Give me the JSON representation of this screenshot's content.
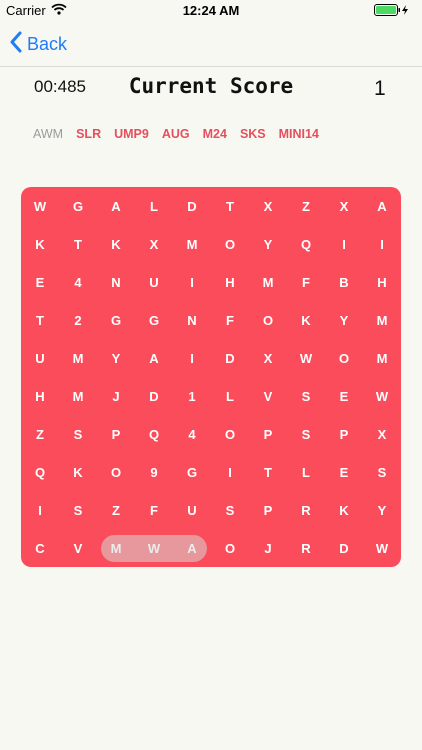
{
  "status_bar": {
    "carrier": "Carrier",
    "time": "12:24 AM"
  },
  "nav": {
    "back_label": "Back"
  },
  "header": {
    "timer": "00:485",
    "title": "Current Score",
    "score": "1"
  },
  "colors": {
    "accent": "#fb4c5b",
    "link": "#1f7cf6",
    "found_word": "#9b9b9b"
  },
  "words": [
    {
      "label": "AWM",
      "found": true
    },
    {
      "label": "SLR",
      "found": false
    },
    {
      "label": "UMP9",
      "found": false
    },
    {
      "label": "AUG",
      "found": false
    },
    {
      "label": "M24",
      "found": false
    },
    {
      "label": "SKS",
      "found": false
    },
    {
      "label": "MINI14",
      "found": false
    }
  ],
  "grid": [
    [
      "W",
      "G",
      "A",
      "L",
      "D",
      "T",
      "X",
      "Z",
      "X",
      "A"
    ],
    [
      "K",
      "T",
      "K",
      "X",
      "M",
      "O",
      "Y",
      "Q",
      "I",
      "I"
    ],
    [
      "E",
      "4",
      "N",
      "U",
      "I",
      "H",
      "M",
      "F",
      "B",
      "H"
    ],
    [
      "T",
      "2",
      "G",
      "G",
      "N",
      "F",
      "O",
      "K",
      "Y",
      "M"
    ],
    [
      "U",
      "M",
      "Y",
      "A",
      "I",
      "D",
      "X",
      "W",
      "O",
      "M"
    ],
    [
      "H",
      "M",
      "J",
      "D",
      "1",
      "L",
      "V",
      "S",
      "E",
      "W"
    ],
    [
      "Z",
      "S",
      "P",
      "Q",
      "4",
      "O",
      "P",
      "S",
      "P",
      "X"
    ],
    [
      "Q",
      "K",
      "O",
      "9",
      "G",
      "I",
      "T",
      "L",
      "E",
      "S"
    ],
    [
      "I",
      "S",
      "Z",
      "F",
      "U",
      "S",
      "P",
      "R",
      "K",
      "Y"
    ],
    [
      "C",
      "V",
      "M",
      "W",
      "A",
      "O",
      "J",
      "R",
      "D",
      "W"
    ]
  ]
}
